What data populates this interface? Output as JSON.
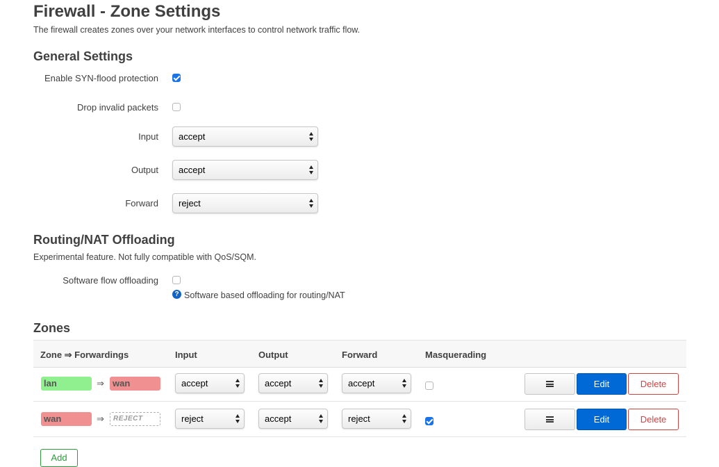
{
  "page": {
    "title": "Firewall - Zone Settings",
    "description": "The firewall creates zones over your network interfaces to control network traffic flow."
  },
  "general": {
    "heading": "General Settings",
    "syn_flood": {
      "label": "Enable SYN-flood protection",
      "checked": true
    },
    "drop_invalid": {
      "label": "Drop invalid packets",
      "checked": false
    },
    "input": {
      "label": "Input",
      "value": "accept"
    },
    "output": {
      "label": "Output",
      "value": "accept"
    },
    "forward": {
      "label": "Forward",
      "value": "reject"
    }
  },
  "offloading": {
    "heading": "Routing/NAT Offloading",
    "description": "Experimental feature. Not fully compatible with QoS/SQM.",
    "software_flow": {
      "label": "Software flow offloading",
      "checked": false
    },
    "help_text": "Software based offloading for routing/NAT",
    "help_icon": "question-circle-icon"
  },
  "zones": {
    "heading": "Zones",
    "columns": {
      "zone": "Zone ⇒ Forwardings",
      "input": "Input",
      "output": "Output",
      "forward": "Forward",
      "masquerading": "Masquerading"
    },
    "arrow": "⇒",
    "rows": [
      {
        "zone": "lan",
        "zone_color": "#90f090",
        "forward_to": "wan",
        "forward_to_color": "#f09090",
        "input": "accept",
        "output": "accept",
        "forward": "accept",
        "masquerading": false
      },
      {
        "zone": "wan",
        "zone_color": "#f09090",
        "forward_to": "REJECT",
        "forward_to_color": "#ffffff",
        "input": "reject",
        "output": "accept",
        "forward": "reject",
        "masquerading": true
      }
    ],
    "buttons": {
      "edit": "Edit",
      "delete": "Delete",
      "menu_icon": "hamburger-menu-icon"
    },
    "add_label": "Add"
  }
}
